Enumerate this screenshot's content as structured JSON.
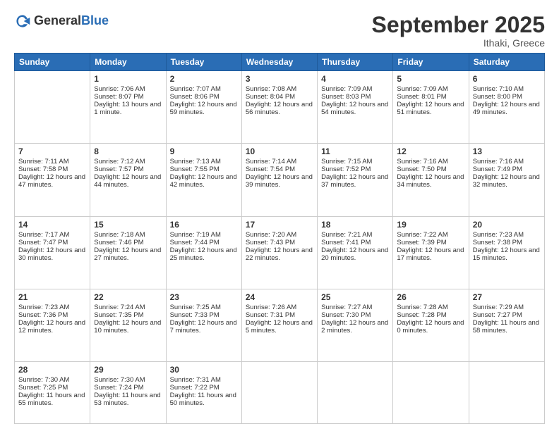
{
  "header": {
    "logo_general": "General",
    "logo_blue": "Blue",
    "month_title": "September 2025",
    "location": "Ithaki, Greece"
  },
  "weekdays": [
    "Sunday",
    "Monday",
    "Tuesday",
    "Wednesday",
    "Thursday",
    "Friday",
    "Saturday"
  ],
  "weeks": [
    [
      {
        "day": "",
        "sunrise": "",
        "sunset": "",
        "daylight": ""
      },
      {
        "day": "1",
        "sunrise": "Sunrise: 7:06 AM",
        "sunset": "Sunset: 8:07 PM",
        "daylight": "Daylight: 13 hours and 1 minute."
      },
      {
        "day": "2",
        "sunrise": "Sunrise: 7:07 AM",
        "sunset": "Sunset: 8:06 PM",
        "daylight": "Daylight: 12 hours and 59 minutes."
      },
      {
        "day": "3",
        "sunrise": "Sunrise: 7:08 AM",
        "sunset": "Sunset: 8:04 PM",
        "daylight": "Daylight: 12 hours and 56 minutes."
      },
      {
        "day": "4",
        "sunrise": "Sunrise: 7:09 AM",
        "sunset": "Sunset: 8:03 PM",
        "daylight": "Daylight: 12 hours and 54 minutes."
      },
      {
        "day": "5",
        "sunrise": "Sunrise: 7:09 AM",
        "sunset": "Sunset: 8:01 PM",
        "daylight": "Daylight: 12 hours and 51 minutes."
      },
      {
        "day": "6",
        "sunrise": "Sunrise: 7:10 AM",
        "sunset": "Sunset: 8:00 PM",
        "daylight": "Daylight: 12 hours and 49 minutes."
      }
    ],
    [
      {
        "day": "7",
        "sunrise": "Sunrise: 7:11 AM",
        "sunset": "Sunset: 7:58 PM",
        "daylight": "Daylight: 12 hours and 47 minutes."
      },
      {
        "day": "8",
        "sunrise": "Sunrise: 7:12 AM",
        "sunset": "Sunset: 7:57 PM",
        "daylight": "Daylight: 12 hours and 44 minutes."
      },
      {
        "day": "9",
        "sunrise": "Sunrise: 7:13 AM",
        "sunset": "Sunset: 7:55 PM",
        "daylight": "Daylight: 12 hours and 42 minutes."
      },
      {
        "day": "10",
        "sunrise": "Sunrise: 7:14 AM",
        "sunset": "Sunset: 7:54 PM",
        "daylight": "Daylight: 12 hours and 39 minutes."
      },
      {
        "day": "11",
        "sunrise": "Sunrise: 7:15 AM",
        "sunset": "Sunset: 7:52 PM",
        "daylight": "Daylight: 12 hours and 37 minutes."
      },
      {
        "day": "12",
        "sunrise": "Sunrise: 7:16 AM",
        "sunset": "Sunset: 7:50 PM",
        "daylight": "Daylight: 12 hours and 34 minutes."
      },
      {
        "day": "13",
        "sunrise": "Sunrise: 7:16 AM",
        "sunset": "Sunset: 7:49 PM",
        "daylight": "Daylight: 12 hours and 32 minutes."
      }
    ],
    [
      {
        "day": "14",
        "sunrise": "Sunrise: 7:17 AM",
        "sunset": "Sunset: 7:47 PM",
        "daylight": "Daylight: 12 hours and 30 minutes."
      },
      {
        "day": "15",
        "sunrise": "Sunrise: 7:18 AM",
        "sunset": "Sunset: 7:46 PM",
        "daylight": "Daylight: 12 hours and 27 minutes."
      },
      {
        "day": "16",
        "sunrise": "Sunrise: 7:19 AM",
        "sunset": "Sunset: 7:44 PM",
        "daylight": "Daylight: 12 hours and 25 minutes."
      },
      {
        "day": "17",
        "sunrise": "Sunrise: 7:20 AM",
        "sunset": "Sunset: 7:43 PM",
        "daylight": "Daylight: 12 hours and 22 minutes."
      },
      {
        "day": "18",
        "sunrise": "Sunrise: 7:21 AM",
        "sunset": "Sunset: 7:41 PM",
        "daylight": "Daylight: 12 hours and 20 minutes."
      },
      {
        "day": "19",
        "sunrise": "Sunrise: 7:22 AM",
        "sunset": "Sunset: 7:39 PM",
        "daylight": "Daylight: 12 hours and 17 minutes."
      },
      {
        "day": "20",
        "sunrise": "Sunrise: 7:23 AM",
        "sunset": "Sunset: 7:38 PM",
        "daylight": "Daylight: 12 hours and 15 minutes."
      }
    ],
    [
      {
        "day": "21",
        "sunrise": "Sunrise: 7:23 AM",
        "sunset": "Sunset: 7:36 PM",
        "daylight": "Daylight: 12 hours and 12 minutes."
      },
      {
        "day": "22",
        "sunrise": "Sunrise: 7:24 AM",
        "sunset": "Sunset: 7:35 PM",
        "daylight": "Daylight: 12 hours and 10 minutes."
      },
      {
        "day": "23",
        "sunrise": "Sunrise: 7:25 AM",
        "sunset": "Sunset: 7:33 PM",
        "daylight": "Daylight: 12 hours and 7 minutes."
      },
      {
        "day": "24",
        "sunrise": "Sunrise: 7:26 AM",
        "sunset": "Sunset: 7:31 PM",
        "daylight": "Daylight: 12 hours and 5 minutes."
      },
      {
        "day": "25",
        "sunrise": "Sunrise: 7:27 AM",
        "sunset": "Sunset: 7:30 PM",
        "daylight": "Daylight: 12 hours and 2 minutes."
      },
      {
        "day": "26",
        "sunrise": "Sunrise: 7:28 AM",
        "sunset": "Sunset: 7:28 PM",
        "daylight": "Daylight: 12 hours and 0 minutes."
      },
      {
        "day": "27",
        "sunrise": "Sunrise: 7:29 AM",
        "sunset": "Sunset: 7:27 PM",
        "daylight": "Daylight: 11 hours and 58 minutes."
      }
    ],
    [
      {
        "day": "28",
        "sunrise": "Sunrise: 7:30 AM",
        "sunset": "Sunset: 7:25 PM",
        "daylight": "Daylight: 11 hours and 55 minutes."
      },
      {
        "day": "29",
        "sunrise": "Sunrise: 7:30 AM",
        "sunset": "Sunset: 7:24 PM",
        "daylight": "Daylight: 11 hours and 53 minutes."
      },
      {
        "day": "30",
        "sunrise": "Sunrise: 7:31 AM",
        "sunset": "Sunset: 7:22 PM",
        "daylight": "Daylight: 11 hours and 50 minutes."
      },
      {
        "day": "",
        "sunrise": "",
        "sunset": "",
        "daylight": ""
      },
      {
        "day": "",
        "sunrise": "",
        "sunset": "",
        "daylight": ""
      },
      {
        "day": "",
        "sunrise": "",
        "sunset": "",
        "daylight": ""
      },
      {
        "day": "",
        "sunrise": "",
        "sunset": "",
        "daylight": ""
      }
    ]
  ]
}
